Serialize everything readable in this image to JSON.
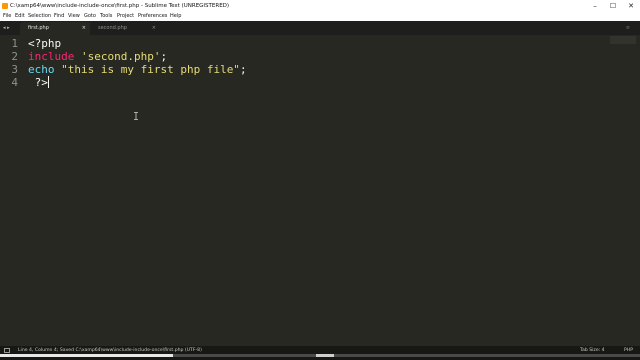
{
  "window": {
    "title": "C:\\xamp64\\www\\include-include-once\\first.php - Sublime Text (UNREGISTERED)",
    "controls": {
      "minimize": "–",
      "maximize": "☐",
      "close": "✕"
    }
  },
  "menu": {
    "items": [
      "File",
      "Edit",
      "Selection",
      "Find",
      "View",
      "Goto",
      "Tools",
      "Project",
      "Preferences",
      "Help"
    ]
  },
  "tabs": {
    "arrows": "◂ ▸",
    "items": [
      {
        "label": "first.php",
        "close": "×",
        "active": true
      },
      {
        "label": "second.php",
        "close": "×",
        "active": false
      }
    ],
    "overflow": "≡"
  },
  "editor": {
    "lines": [
      {
        "number": "1",
        "parts": [
          [
            "plain",
            "<?php"
          ]
        ]
      },
      {
        "number": "2",
        "parts": [
          [
            "include",
            "include"
          ],
          [
            "plain",
            " "
          ],
          [
            "str",
            "'second.php'"
          ],
          [
            "plain",
            ";"
          ]
        ]
      },
      {
        "number": "3",
        "parts": [
          [
            "echo",
            "echo"
          ],
          [
            "plain",
            " "
          ],
          [
            "str",
            "\"this is my first php file\""
          ],
          [
            "plain",
            ";"
          ]
        ]
      },
      {
        "number": "4",
        "parts": [
          [
            "plain",
            " ?>"
          ]
        ]
      }
    ],
    "colors": {
      "background": "#272822",
      "keyword_include": "#f92672",
      "keyword_echo": "#66d9ef",
      "string": "#e6db74",
      "plain": "#f8f8f2",
      "gutter": "#90908a"
    }
  },
  "status": {
    "left": "Line 4, Column 4; Saved C:\\xamp64\\www\\include-include-once\\first.php (UTF-8)",
    "tab_size": "Tab Size: 4",
    "syntax": "PHP"
  },
  "video": {
    "progress_fraction": 0.27
  }
}
